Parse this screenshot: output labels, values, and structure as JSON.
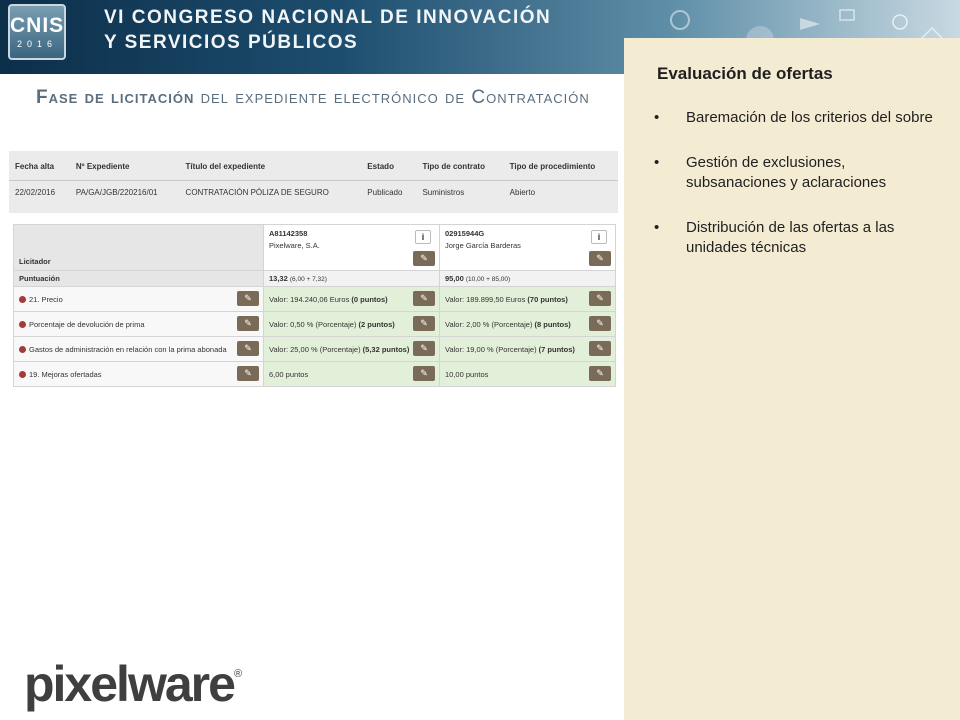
{
  "banner": {
    "logo_top": "CNIS",
    "logo_bottom": "2016",
    "line1": "VI CONGRESO NACIONAL DE INNOVACIÓN",
    "line2": "Y SERVICIOS PÚBLICOS"
  },
  "slide": {
    "title_bold": "Fase de licitación",
    "title_rest": " del expediente electrónico de Contratación"
  },
  "expediente": {
    "headers": [
      "Fecha alta",
      "Nº Expediente",
      "Título del expediente",
      "Estado",
      "Tipo de contrato",
      "Tipo de procedimiento"
    ],
    "row": [
      "22/02/2016",
      "PA/GA/JGB/220216/01",
      "CONTRATACIÓN PÓLIZA DE SEGURO",
      "Publicado",
      "Suministros",
      "Abierto"
    ]
  },
  "ofertas": {
    "licitador_label": "Licitador",
    "puntuacion_label": "Puntuación",
    "info_label": "i",
    "edit_glyph": "✎",
    "licitadores": [
      {
        "id": "A81142358",
        "name": "Pixelware, S.A.",
        "total": "13,32",
        "breakdown": "(6,00 + 7,32)",
        "values": [
          {
            "text": "Valor: 194.240,06 Euros ",
            "points": "(0 puntos)"
          },
          {
            "text": "Valor: 0,50 % (Porcentaje) ",
            "points": "(2 puntos)"
          },
          {
            "text": "Valor: 25,00 % (Porcentaje) ",
            "points": "(5,32 puntos)"
          },
          {
            "text": "6,00 puntos",
            "points": ""
          }
        ]
      },
      {
        "id": "02915944G",
        "name": "Jorge García Barderas",
        "total": "95,00",
        "breakdown": "(10,00 + 85,00)",
        "values": [
          {
            "text": "Valor: 189.899,50 Euros ",
            "points": "(70 puntos)"
          },
          {
            "text": "Valor: 2,00 % (Porcentaje) ",
            "points": "(8 puntos)"
          },
          {
            "text": "Valor: 19,00 % (Porcentaje) ",
            "points": "(7 puntos)"
          },
          {
            "text": "10,00 puntos",
            "points": ""
          }
        ]
      }
    ],
    "criterios": [
      "21. Precio",
      "Porcentaje de devolución de prima",
      "Gastos de administración en relación con la prima abonada",
      "19. Mejoras ofertadas"
    ]
  },
  "logo": {
    "text": "pixelware",
    "reg": "®"
  },
  "panel": {
    "title": "Evaluación de ofertas",
    "bullets": [
      "Baremación de los criterios del sobre",
      "Gestión de exclusiones, subsanaciones y aclaraciones",
      "Distribución de las ofertas a las unidades técnicas"
    ]
  },
  "colors": {
    "panel_bg": "#f4ebd3",
    "title_color": "#5a6e7f",
    "cell_green": "#e3f0d9",
    "edit_button": "#7a6a58",
    "criterion_dot": "#a33b3b"
  }
}
